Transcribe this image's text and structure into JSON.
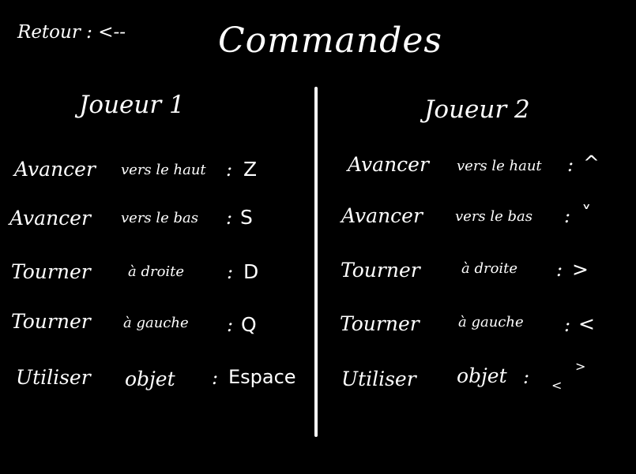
{
  "header": {
    "back_label": "Retour : <--",
    "title": "Commandes"
  },
  "player1": {
    "title": "Joueur 1",
    "rows": [
      {
        "verb": "Avancer",
        "detail": "vers le haut",
        "sep": ":",
        "key": "Z"
      },
      {
        "verb": "Avancer",
        "detail": "vers le bas",
        "sep": ":",
        "key": "S"
      },
      {
        "verb": "Tourner",
        "detail": "à droite",
        "sep": ":",
        "key": "D"
      },
      {
        "verb": "Tourner",
        "detail": "à gauche",
        "sep": ":",
        "key": "Q"
      },
      {
        "verb": "Utiliser",
        "detail": "objet",
        "sep": ":",
        "key": "Espace"
      }
    ]
  },
  "player2": {
    "title": "Joueur 2",
    "rows": [
      {
        "verb": "Avancer",
        "detail": "vers le haut",
        "sep": ":",
        "key": "^"
      },
      {
        "verb": "Avancer",
        "detail": "vers le bas",
        "sep": ":",
        "key": "˅"
      },
      {
        "verb": "Tourner",
        "detail": "à droite",
        "sep": ":",
        "key": ">"
      },
      {
        "verb": "Tourner",
        "detail": "à gauche",
        "sep": ":",
        "key": "<"
      },
      {
        "verb": "Utiliser",
        "detail": "objet",
        "sep": ":",
        "key_top": ">",
        "key_bottom": "<"
      }
    ]
  }
}
